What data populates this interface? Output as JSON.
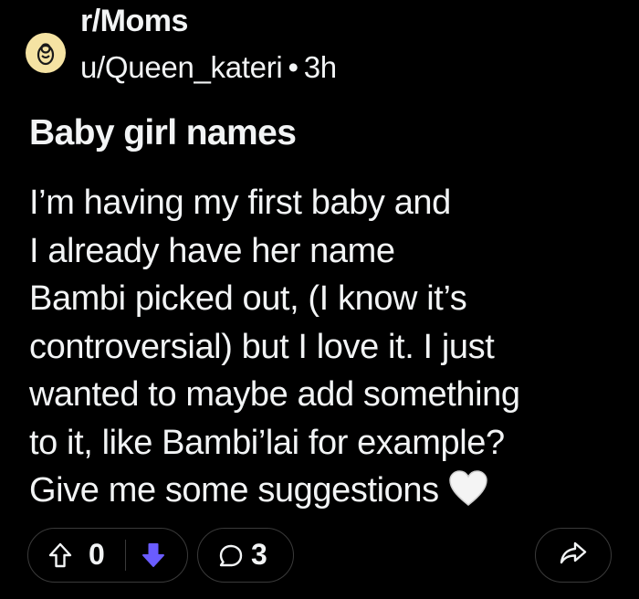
{
  "post": {
    "subreddit": "r/Moms",
    "author": "u/Queen_kateri",
    "separator": "•",
    "time": "3h",
    "title": "Baby girl names",
    "body_lines": [
      "I’m having my first baby and",
      "I already have her name",
      "Bambi picked out, (I know it’s",
      "controversial) but I love it. I just",
      "wanted to maybe add something",
      "to it, like Bambi’lai for example?",
      "Give me some suggestions"
    ]
  },
  "actions": {
    "vote_count": "0",
    "comment_count": "3"
  },
  "colors": {
    "background": "#000000",
    "text": "#f2f4f5",
    "downvote_accent": "#6a5cff",
    "avatar_bg": "#f5e3a3",
    "pill_border": "#3a3a3a"
  },
  "icons": {
    "avatar": "subreddit-avatar-icon",
    "upvote": "upvote-arrow-icon",
    "downvote": "downvote-arrow-icon",
    "comment": "comment-bubble-icon",
    "share": "share-arrow-icon",
    "emoji": "white-heart-emoji"
  }
}
